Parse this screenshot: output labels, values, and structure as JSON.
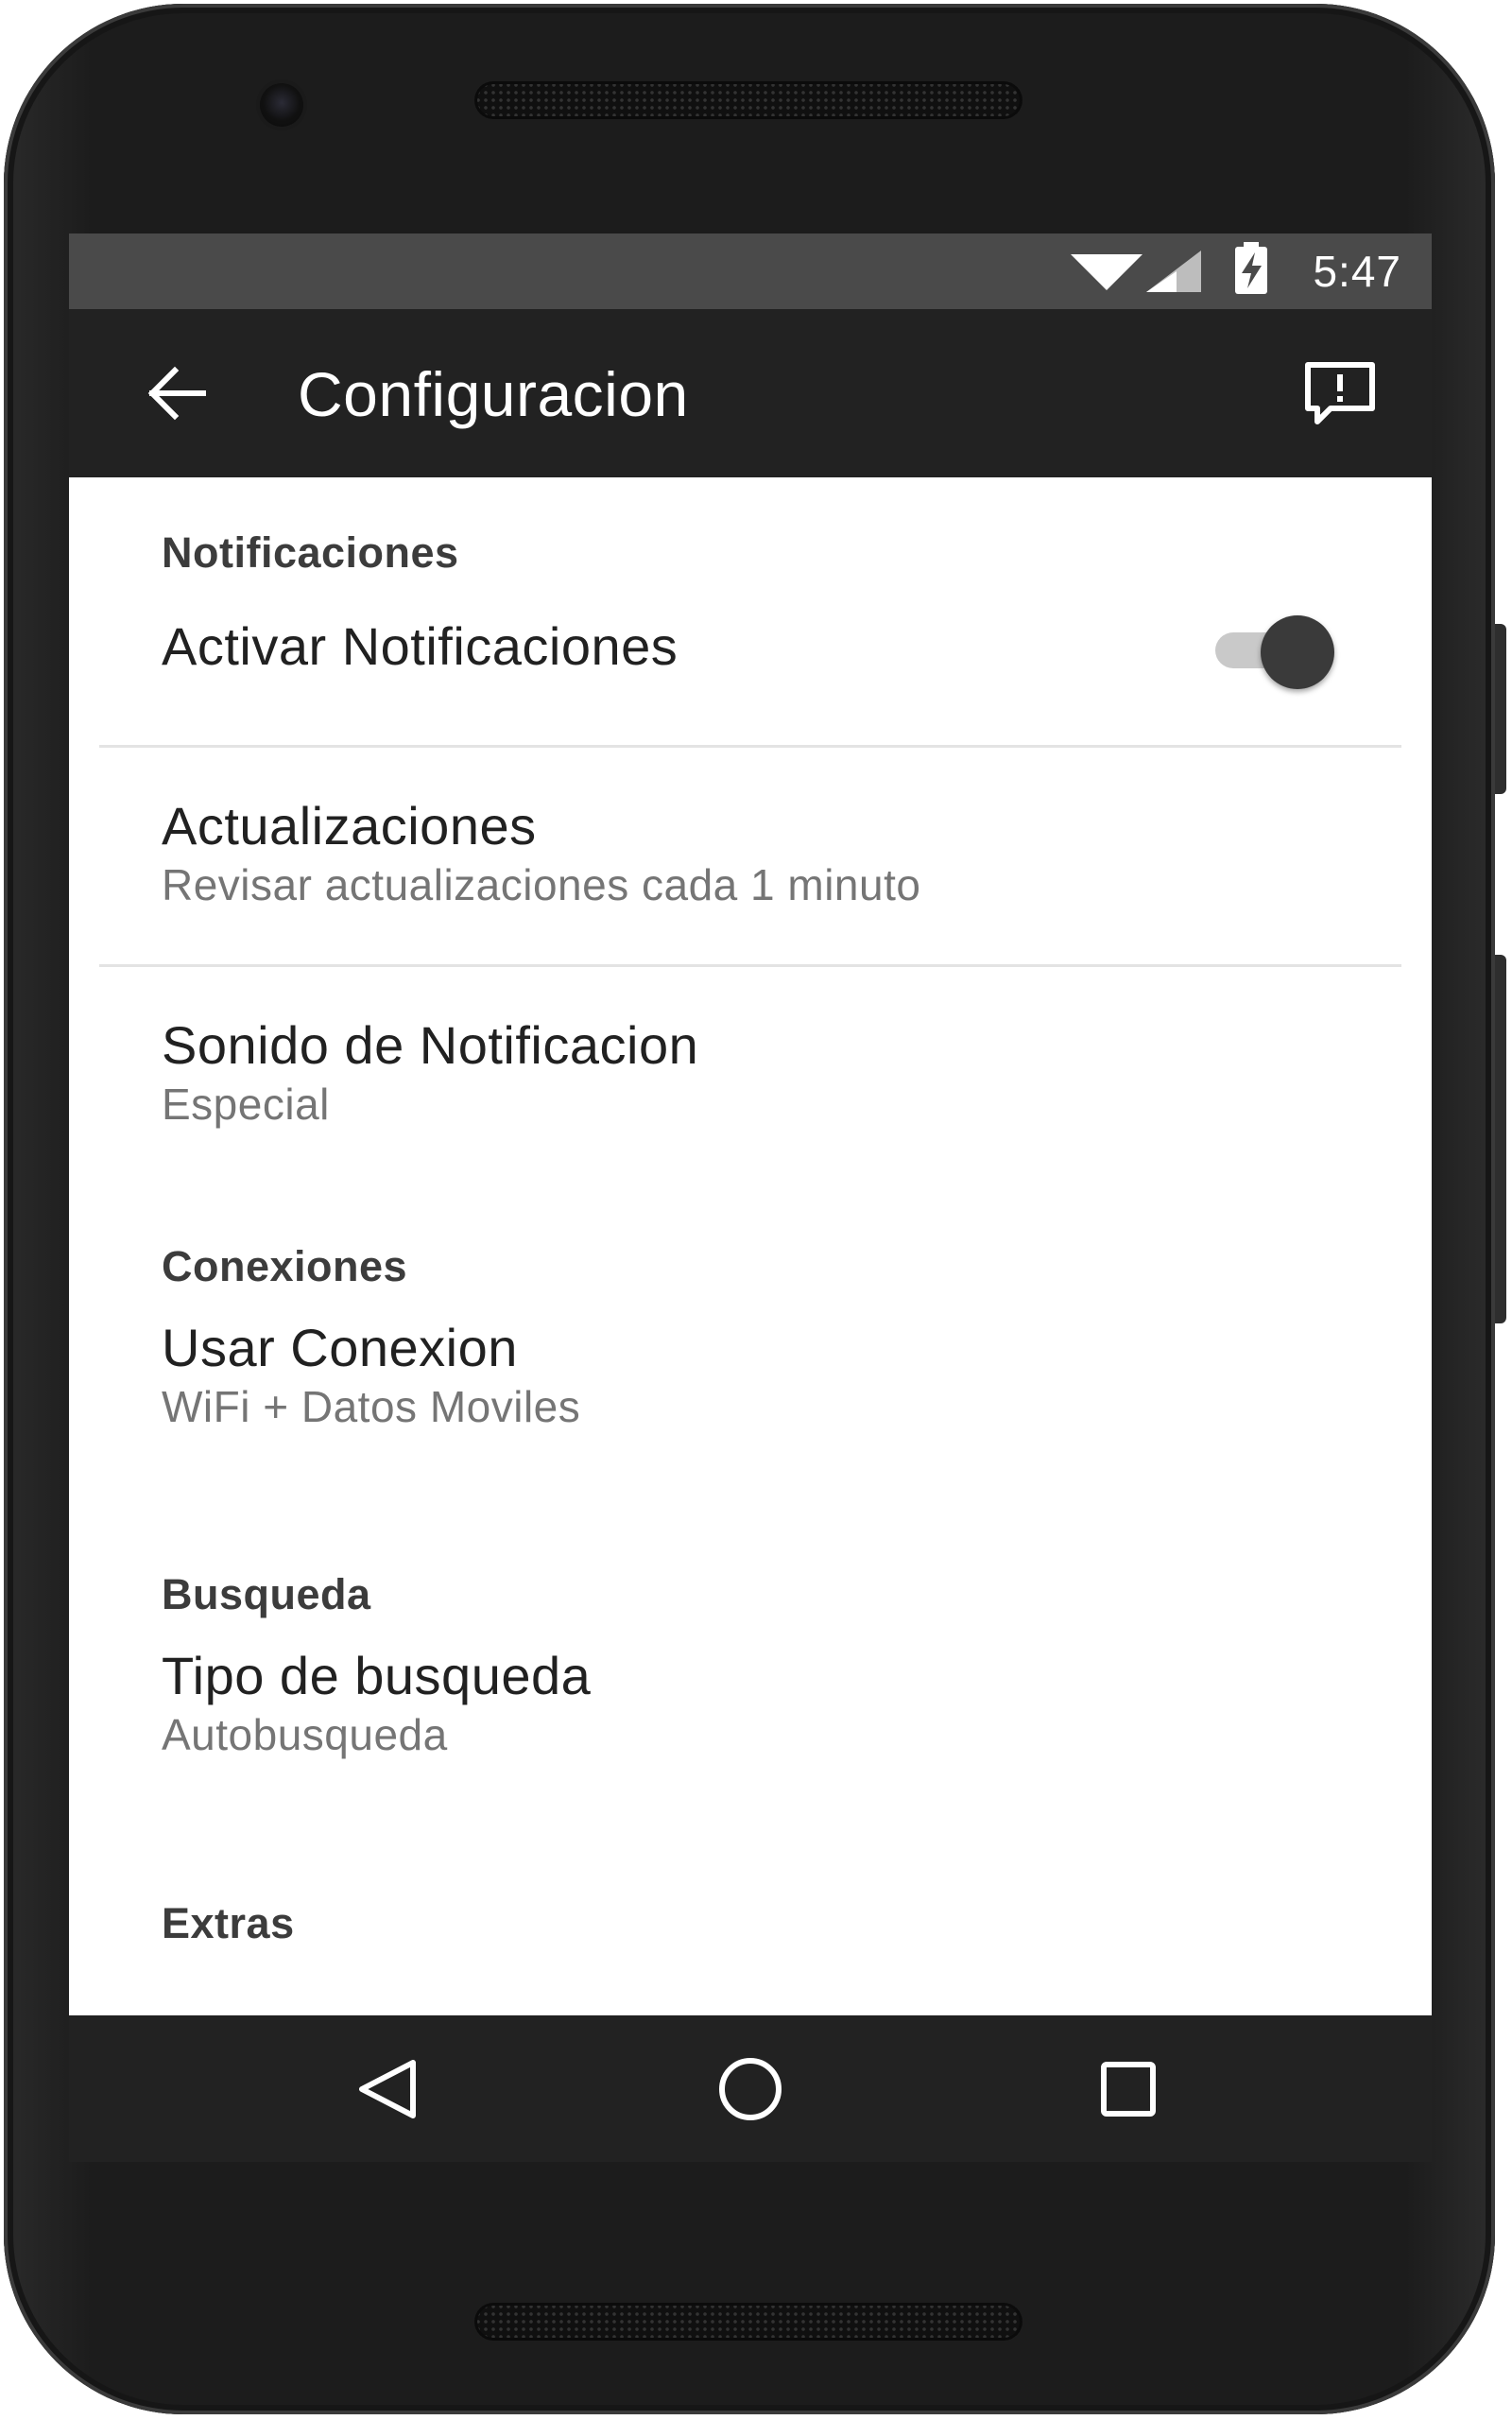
{
  "status_bar": {
    "time": "5:47",
    "icons": [
      "wifi-icon",
      "cell-signal-icon",
      "battery-charging-icon"
    ]
  },
  "app_bar": {
    "title": "Configuracion",
    "back_icon": "arrow-back-icon",
    "action_icon": "feedback-icon"
  },
  "sections": [
    {
      "header": "Notificaciones",
      "items": [
        {
          "title": "Activar Notificaciones",
          "toggle": true,
          "toggle_on": true
        }
      ]
    },
    {
      "header": "",
      "items": [
        {
          "title": "Actualizaciones",
          "summary": "Revisar actualizaciones cada 1 minuto"
        },
        {
          "title": "Sonido de Notificacion",
          "summary": "Especial"
        }
      ]
    },
    {
      "header": "Conexiones",
      "items": [
        {
          "title": "Usar Conexion",
          "summary": "WiFi + Datos Moviles"
        }
      ]
    },
    {
      "header": "Busqueda",
      "items": [
        {
          "title": "Tipo de busqueda",
          "summary": "Autobusqueda"
        }
      ]
    },
    {
      "header": "Extras",
      "items": []
    }
  ],
  "nav_bar": {
    "buttons": [
      "back-triangle-icon",
      "home-circle-icon",
      "recents-square-icon"
    ]
  },
  "colors": {
    "status_bar": "#4a4a4a",
    "app_bar": "#222222",
    "toggle_thumb": "#3a3a3a",
    "toggle_track": "#c9c9c9"
  }
}
